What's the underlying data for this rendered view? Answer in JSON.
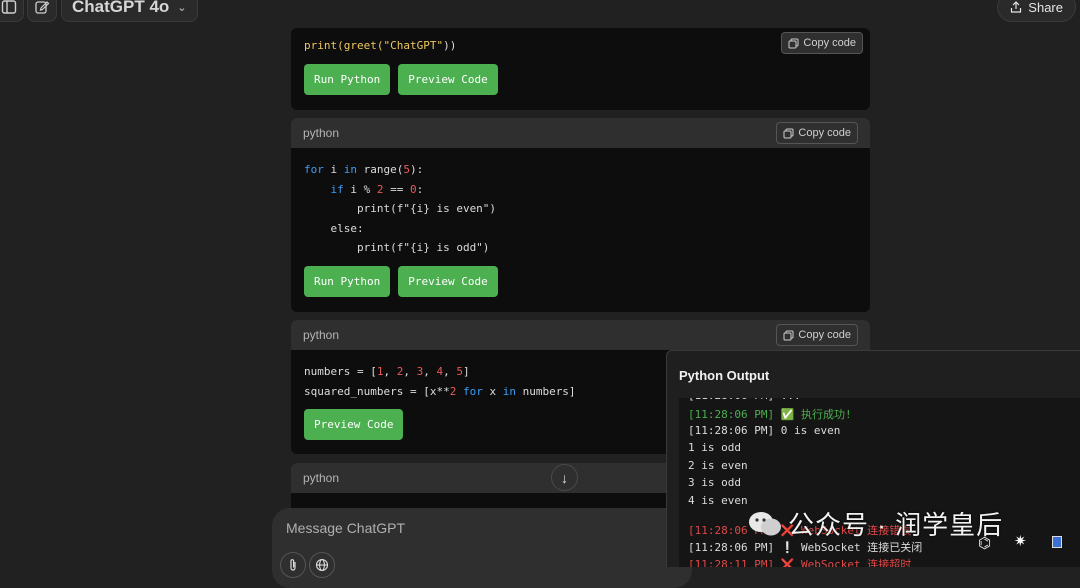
{
  "header": {
    "model_name": "ChatGPT 4o",
    "share_label": "Share"
  },
  "blocks": [
    {
      "lang": "",
      "copy_label": "Copy code",
      "lines": [
        [
          {
            "t": "print(greet(",
            "c": "fn"
          },
          {
            "t": "\"ChatGPT\"",
            "c": "str"
          },
          {
            "t": "))",
            "c": ""
          }
        ]
      ],
      "buttons": [
        "Run Python",
        "Preview Code"
      ]
    },
    {
      "lang": "python",
      "copy_label": "Copy code",
      "lines": [
        [
          {
            "t": "for",
            "c": "kw"
          },
          {
            "t": " i ",
            "c": ""
          },
          {
            "t": "in",
            "c": "kw"
          },
          {
            "t": " range(",
            "c": ""
          },
          {
            "t": "5",
            "c": "num"
          },
          {
            "t": "):",
            "c": ""
          }
        ],
        [
          {
            "t": "    ",
            "c": ""
          },
          {
            "t": "if",
            "c": "kw"
          },
          {
            "t": " i % ",
            "c": ""
          },
          {
            "t": "2",
            "c": "num"
          },
          {
            "t": " == ",
            "c": ""
          },
          {
            "t": "0",
            "c": "num"
          },
          {
            "t": ":",
            "c": ""
          }
        ],
        [
          {
            "t": "        print(f\"{i} is even\")",
            "c": ""
          }
        ],
        [
          {
            "t": "    else:",
            "c": ""
          }
        ],
        [
          {
            "t": "        print(f\"{i} is odd\")",
            "c": ""
          }
        ]
      ],
      "buttons": [
        "Run Python",
        "Preview Code"
      ]
    },
    {
      "lang": "python",
      "copy_label": "Copy code",
      "lines": [
        [
          {
            "t": "numbers = [",
            "c": ""
          },
          {
            "t": "1",
            "c": "num"
          },
          {
            "t": ", ",
            "c": ""
          },
          {
            "t": "2",
            "c": "num"
          },
          {
            "t": ", ",
            "c": ""
          },
          {
            "t": "3",
            "c": "num"
          },
          {
            "t": ", ",
            "c": ""
          },
          {
            "t": "4",
            "c": "num"
          },
          {
            "t": ", ",
            "c": ""
          },
          {
            "t": "5",
            "c": "num"
          },
          {
            "t": "]",
            "c": ""
          }
        ],
        [
          {
            "t": "squared_numbers = [x**",
            "c": ""
          },
          {
            "t": "2",
            "c": "num"
          },
          {
            "t": " ",
            "c": ""
          },
          {
            "t": "for",
            "c": "kw"
          },
          {
            "t": " x ",
            "c": ""
          },
          {
            "t": "in",
            "c": "kw"
          },
          {
            "t": " numbers]",
            "c": ""
          }
        ]
      ],
      "buttons": [
        "Preview Code"
      ]
    },
    {
      "lang": "python",
      "copy_label": "",
      "lines": [],
      "buttons": []
    }
  ],
  "composer": {
    "placeholder": "Message ChatGPT"
  },
  "output_panel": {
    "title": "Python Output",
    "logs": [
      {
        "text": "[11:28:06 PM] ✅ 执行成功!",
        "style": "green"
      },
      {
        "text": "[11:28:06 PM] 0 is even",
        "style": ""
      },
      {
        "text": "1 is odd",
        "style": ""
      },
      {
        "text": "2 is even",
        "style": ""
      },
      {
        "text": "3 is odd",
        "style": ""
      },
      {
        "text": "4 is even",
        "style": ""
      },
      {
        "text": "[11:28:06 PM] ❌ WebSocket 连接错误",
        "style": "red"
      },
      {
        "text": "[11:28:06 PM] ❕ WebSocket 连接已关闭",
        "style": ""
      },
      {
        "text": "[11:28:11 PM] ❌ WebSocket 连接超时",
        "style": "red"
      }
    ]
  },
  "watermark": {
    "text": "公众号 · 润学皇后"
  },
  "colors": {
    "green_button": "#4caf50",
    "keyword": "#3d9cf5",
    "number": "#e85a5a",
    "string": "#f0c75e"
  }
}
